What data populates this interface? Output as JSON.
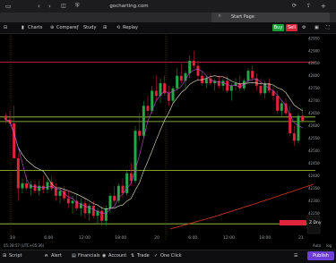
{
  "browser": {
    "address": "gocharting.com",
    "tab_title": "Start Page"
  },
  "toolbar": {
    "charts": "Charts",
    "compare": "Compare",
    "study": "Study",
    "replay": "Replay",
    "buy": "Buy",
    "sell": "Sell"
  },
  "chart_data": {
    "type": "candlestick",
    "x_ticks": [
      "19",
      "6:00",
      "12:00",
      "18:00",
      "20",
      "6:00",
      "12:00",
      "18:00",
      "21"
    ],
    "y_ticks": [
      "42950",
      "42900",
      "42850",
      "42800",
      "42750",
      "42700",
      "42650",
      "42600",
      "42550",
      "42500",
      "42450",
      "42400",
      "42350",
      "42300",
      "42250",
      "42200"
    ],
    "horizontal_levels": [
      {
        "price": 42855,
        "color": "#e0243a"
      },
      {
        "price": 42635,
        "color": "#a8d840"
      },
      {
        "price": 42617,
        "color": "#a8d840"
      },
      {
        "price": 42422,
        "color": "#a8d840"
      },
      {
        "price": 42208,
        "color": "#a8d840"
      }
    ],
    "colors": {
      "up": "#26a647",
      "down": "#e0243a",
      "ma_fast": "#c050d0",
      "ma_slow": "#e8e8c8",
      "ma_long": "#d83a2a"
    },
    "candles": [
      [
        42640,
        42650,
        42610,
        42625
      ],
      [
        42625,
        42660,
        42600,
        42610
      ],
      [
        42610,
        42680,
        42590,
        42470
      ],
      [
        42470,
        42490,
        42300,
        42350
      ],
      [
        42350,
        42390,
        42330,
        42370
      ],
      [
        42370,
        42400,
        42340,
        42350
      ],
      [
        42350,
        42380,
        42320,
        42365
      ],
      [
        42365,
        42380,
        42330,
        42340
      ],
      [
        42340,
        42380,
        42320,
        42360
      ],
      [
        42360,
        42400,
        42330,
        42345
      ],
      [
        42345,
        42390,
        42330,
        42375
      ],
      [
        42375,
        42400,
        42340,
        42350
      ],
      [
        42350,
        42370,
        42300,
        42320
      ],
      [
        42320,
        42350,
        42290,
        42340
      ],
      [
        42340,
        42360,
        42300,
        42310
      ],
      [
        42310,
        42340,
        42270,
        42290
      ],
      [
        42290,
        42320,
        42250,
        42300
      ],
      [
        42300,
        42330,
        42260,
        42270
      ],
      [
        42270,
        42310,
        42240,
        42290
      ],
      [
        42290,
        42310,
        42230,
        42250
      ],
      [
        42250,
        42290,
        42220,
        42280
      ],
      [
        42280,
        42300,
        42230,
        42240
      ],
      [
        42240,
        42270,
        42210,
        42260
      ],
      [
        42260,
        42280,
        42200,
        42220
      ],
      [
        42220,
        42280,
        42200,
        42270
      ],
      [
        42270,
        42330,
        42250,
        42320
      ],
      [
        42320,
        42360,
        42290,
        42300
      ],
      [
        42300,
        42370,
        42290,
        42360
      ],
      [
        42360,
        42390,
        42310,
        42330
      ],
      [
        42330,
        42420,
        42320,
        42410
      ],
      [
        42410,
        42450,
        42360,
        42380
      ],
      [
        42380,
        42600,
        42370,
        42580
      ],
      [
        42580,
        42650,
        42540,
        42560
      ],
      [
        42560,
        42700,
        42550,
        42680
      ],
      [
        42680,
        42720,
        42640,
        42660
      ],
      [
        42660,
        42760,
        42650,
        42740
      ],
      [
        42740,
        42800,
        42700,
        42720
      ],
      [
        42720,
        42790,
        42690,
        42770
      ],
      [
        42770,
        42800,
        42720,
        42730
      ],
      [
        42730,
        42760,
        42680,
        42700
      ],
      [
        42700,
        42760,
        42690,
        42750
      ],
      [
        42750,
        42830,
        42740,
        42800
      ],
      [
        42800,
        42850,
        42770,
        42780
      ],
      [
        42780,
        42820,
        42750,
        42810
      ],
      [
        42810,
        42880,
        42790,
        42860
      ],
      [
        42860,
        42900,
        42830,
        42840
      ],
      [
        42840,
        42860,
        42780,
        42800
      ],
      [
        42800,
        42820,
        42760,
        42770
      ],
      [
        42770,
        42800,
        42750,
        42790
      ],
      [
        42790,
        42810,
        42760,
        42770
      ],
      [
        42770,
        42790,
        42740,
        42780
      ],
      [
        42780,
        42800,
        42750,
        42760
      ],
      [
        42760,
        42790,
        42740,
        42780
      ],
      [
        42780,
        42800,
        42730,
        42740
      ],
      [
        42740,
        42770,
        42700,
        42760
      ],
      [
        42760,
        42790,
        42740,
        42770
      ],
      [
        42770,
        42800,
        42740,
        42750
      ],
      [
        42750,
        42790,
        42740,
        42780
      ],
      [
        42780,
        42830,
        42770,
        42820
      ],
      [
        42820,
        42840,
        42780,
        42790
      ],
      [
        42790,
        42810,
        42740,
        42760
      ],
      [
        42760,
        42790,
        42720,
        42730
      ],
      [
        42730,
        42780,
        42710,
        42770
      ],
      [
        42770,
        42790,
        42730,
        42740
      ],
      [
        42740,
        42760,
        42700,
        42720
      ],
      [
        42720,
        42740,
        42650,
        42660
      ],
      [
        42660,
        42700,
        42640,
        42690
      ],
      [
        42690,
        42710,
        42640,
        42650
      ],
      [
        42650,
        42680,
        42560,
        42570
      ],
      [
        42570,
        42600,
        42520,
        42540
      ],
      [
        42540,
        42650,
        42530,
        42640
      ],
      [
        42640,
        42670,
        42610,
        42620
      ]
    ],
    "current_price_label": "Z Dny"
  },
  "bottom": {
    "script": "Script",
    "alert": "Alert",
    "financials": "Financials",
    "account": "Account",
    "trade": "Trade",
    "one_click": "One Click",
    "publish": "Publish",
    "timestamp": "05:28:57 (UTC+05:30)",
    "auto": "Auto",
    "log": "log"
  }
}
